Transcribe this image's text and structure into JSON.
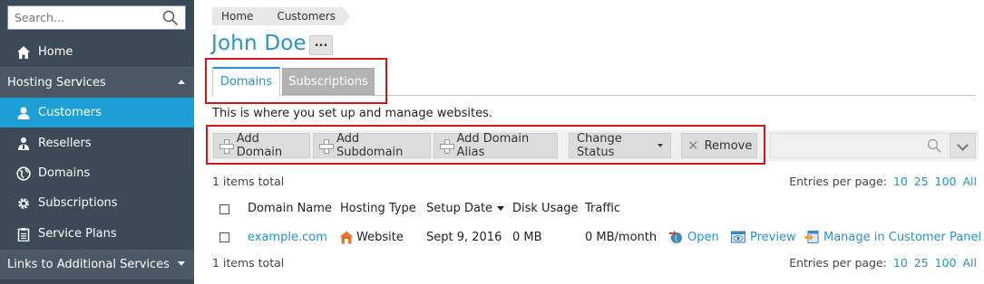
{
  "sidebar": {
    "search_placeholder": "Search...",
    "items": [
      {
        "label": "Home",
        "icon": "home-icon"
      },
      {
        "label": "Hosting Services",
        "icon": "chevron-up-icon"
      },
      {
        "label": "Customers",
        "icon": "user-icon"
      },
      {
        "label": "Resellers",
        "icon": "reseller-icon"
      },
      {
        "label": "Domains",
        "icon": "globe-icon"
      },
      {
        "label": "Subscriptions",
        "icon": "gear-icon"
      },
      {
        "label": "Service Plans",
        "icon": "clipboard-icon"
      },
      {
        "label": "Links to Additional Services",
        "icon": "chevron-down-icon"
      }
    ],
    "active_color": "#1e9fd6",
    "bg_color": "#3c4a57"
  },
  "breadcrumb": [
    "Home",
    "Customers"
  ],
  "page_title": "John Doe",
  "more_label": "...",
  "tabs": [
    {
      "label": "Domains",
      "active": true
    },
    {
      "label": "Subscriptions",
      "active": false
    }
  ],
  "description": "This is where you set up and manage websites.",
  "toolbar": {
    "add_domain": "Add Domain",
    "add_subdomain": "Add Subdomain",
    "add_domain_alias": "Add Domain Alias",
    "change_status": "Change Status",
    "remove": "Remove"
  },
  "list": {
    "items_total": "1 items total",
    "per_page_label": "Entries per page:",
    "per_page_options": [
      "10",
      "25",
      "100",
      "All"
    ],
    "columns": [
      "Domain Name",
      "Hosting Type",
      "Setup Date",
      "Disk Usage",
      "Traffic"
    ],
    "rows": [
      {
        "domain": "example.com",
        "hosting_type": "Website",
        "setup_date": "Sept 9, 2016",
        "disk_usage": "0 MB",
        "traffic": "0 MB/month",
        "actions": [
          "Open",
          "Preview",
          "Manage in Customer Panel"
        ]
      }
    ]
  },
  "colors": {
    "accent": "#2594d0",
    "highlight_border": "#d9131a"
  }
}
